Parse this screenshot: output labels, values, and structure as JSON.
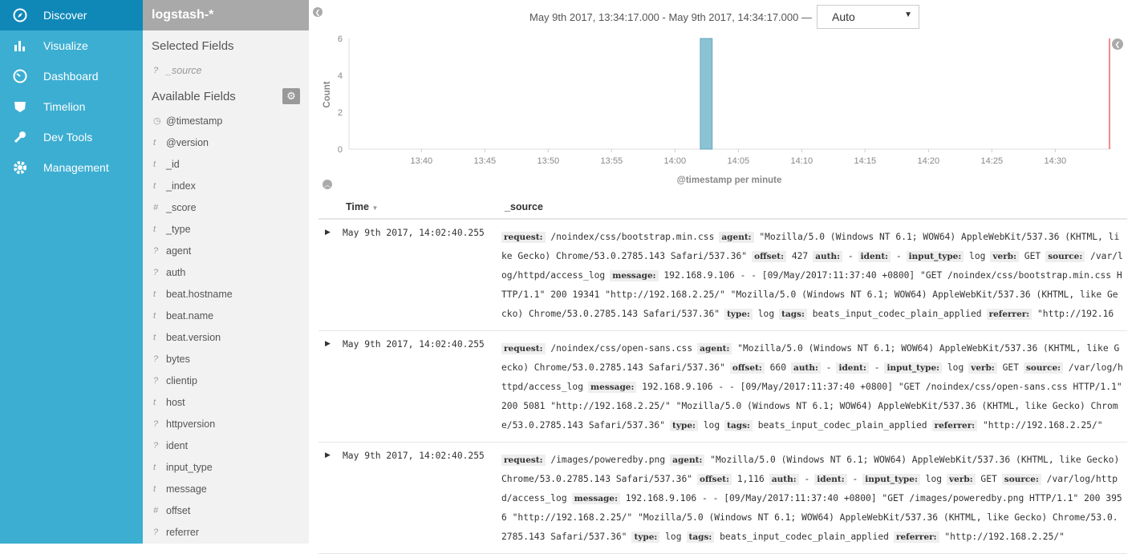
{
  "nav": [
    {
      "label": "Discover",
      "icon": "compass-icon",
      "active": true
    },
    {
      "label": "Visualize",
      "icon": "bar-chart-icon"
    },
    {
      "label": "Dashboard",
      "icon": "dashboard-icon"
    },
    {
      "label": "Timelion",
      "icon": "timelion-icon"
    },
    {
      "label": "Dev Tools",
      "icon": "wrench-icon"
    },
    {
      "label": "Management",
      "icon": "gear-icon"
    }
  ],
  "index_pattern": "logstash-*",
  "selected_fields_title": "Selected Fields",
  "selected_fields": [
    {
      "type": "?",
      "name": "_source"
    }
  ],
  "available_fields_title": "Available Fields",
  "available_fields": [
    {
      "type": "clock",
      "name": "@timestamp"
    },
    {
      "type": "t",
      "name": "@version"
    },
    {
      "type": "t",
      "name": "_id"
    },
    {
      "type": "t",
      "name": "_index"
    },
    {
      "type": "#",
      "name": "_score"
    },
    {
      "type": "t",
      "name": "_type"
    },
    {
      "type": "?",
      "name": "agent"
    },
    {
      "type": "?",
      "name": "auth"
    },
    {
      "type": "t",
      "name": "beat.hostname"
    },
    {
      "type": "t",
      "name": "beat.name"
    },
    {
      "type": "t",
      "name": "beat.version"
    },
    {
      "type": "?",
      "name": "bytes"
    },
    {
      "type": "?",
      "name": "clientip"
    },
    {
      "type": "t",
      "name": "host"
    },
    {
      "type": "?",
      "name": "httpversion"
    },
    {
      "type": "?",
      "name": "ident"
    },
    {
      "type": "t",
      "name": "input_type"
    },
    {
      "type": "t",
      "name": "message"
    },
    {
      "type": "#",
      "name": "offset"
    },
    {
      "type": "?",
      "name": "referrer"
    }
  ],
  "time_range": "May 9th 2017, 13:34:17.000 - May 9th 2017, 14:34:17.000 —",
  "interval": "Auto",
  "chart_data": {
    "type": "bar",
    "xlabel": "@timestamp per minute",
    "ylabel": "Count",
    "x_range": [
      "13:34:17",
      "14:34:17"
    ],
    "ylim": [
      0,
      6
    ],
    "yticks": [
      0,
      2,
      4,
      6
    ],
    "xticks": [
      "13:40",
      "13:45",
      "13:50",
      "13:55",
      "14:00",
      "14:05",
      "14:10",
      "14:15",
      "14:20",
      "14:25",
      "14:30"
    ],
    "bars": [
      {
        "x": "14:02",
        "value": 6
      }
    ],
    "bar_color": "#8bc3d4",
    "now_marker_color": "#e66"
  },
  "table": {
    "headers": {
      "time": "Time",
      "source": "_source"
    },
    "rows": [
      {
        "time": "May 9th 2017, 14:02:40.255",
        "fields": [
          [
            "request:",
            "/noindex/css/bootstrap.min.css"
          ],
          [
            "agent:",
            "\"Mozilla/5.0 (Windows NT 6.1; WOW64) AppleWebKit/537.36 (KHTML, like Gecko) Chrome/53.0.2785.143 Safari/537.36\""
          ],
          [
            "offset:",
            "427"
          ],
          [
            "auth:",
            "-"
          ],
          [
            "ident:",
            "-"
          ],
          [
            "input_type:",
            "log"
          ],
          [
            "verb:",
            "GET"
          ],
          [
            "source:",
            "/var/log/httpd/access_log"
          ],
          [
            "message:",
            "192.168.9.106 - - [09/May/2017:11:37:40 +0800] \"GET /noindex/css/bootstrap.min.css HTTP/1.1\" 200 19341 \"http://192.168.2.25/\" \"Mozilla/5.0 (Windows NT 6.1; WOW64) AppleWebKit/537.36 (KHTML, like Gecko) Chrome/53.0.2785.143 Safari/537.36\""
          ],
          [
            "type:",
            "log"
          ],
          [
            "tags:",
            "beats_input_codec_plain_applied"
          ],
          [
            "referrer:",
            "\"http://192.168.2.25/\""
          ]
        ]
      },
      {
        "time": "May 9th 2017, 14:02:40.255",
        "fields": [
          [
            "request:",
            "/noindex/css/open-sans.css"
          ],
          [
            "agent:",
            "\"Mozilla/5.0 (Windows NT 6.1; WOW64) AppleWebKit/537.36 (KHTML, like Gecko) Chrome/53.0.2785.143 Safari/537.36\""
          ],
          [
            "offset:",
            "660"
          ],
          [
            "auth:",
            "-"
          ],
          [
            "ident:",
            "-"
          ],
          [
            "input_type:",
            "log"
          ],
          [
            "verb:",
            "GET"
          ],
          [
            "source:",
            "/var/log/httpd/access_log"
          ],
          [
            "message:",
            "192.168.9.106 - - [09/May/2017:11:37:40 +0800] \"GET /noindex/css/open-sans.css HTTP/1.1\" 200 5081 \"http://192.168.2.25/\" \"Mozilla/5.0 (Windows NT 6.1; WOW64) AppleWebKit/537.36 (KHTML, like Gecko) Chrome/53.0.2785.143 Safari/537.36\""
          ],
          [
            "type:",
            "log"
          ],
          [
            "tags:",
            "beats_input_codec_plain_applied"
          ],
          [
            "referrer:",
            "\"http://192.168.2.25/\""
          ]
        ]
      },
      {
        "time": "May 9th 2017, 14:02:40.255",
        "fields": [
          [
            "request:",
            "/images/poweredby.png"
          ],
          [
            "agent:",
            "\"Mozilla/5.0 (Windows NT 6.1; WOW64) AppleWebKit/537.36 (KHTML, like Gecko) Chrome/53.0.2785.143 Safari/537.36\""
          ],
          [
            "offset:",
            "1,116"
          ],
          [
            "auth:",
            "-"
          ],
          [
            "ident:",
            "-"
          ],
          [
            "input_type:",
            "log"
          ],
          [
            "verb:",
            "GET"
          ],
          [
            "source:",
            "/var/log/httpd/access_log"
          ],
          [
            "message:",
            "192.168.9.106 - - [09/May/2017:11:37:40 +0800] \"GET /images/poweredby.png HTTP/1.1\" 200 3956 \"http://192.168.2.25/\" \"Mozilla/5.0 (Windows NT 6.1; WOW64) AppleWebKit/537.36 (KHTML, like Gecko) Chrome/53.0.2785.143 Safari/537.36\""
          ],
          [
            "type:",
            "log"
          ],
          [
            "tags:",
            "beats_input_codec_plain_applied"
          ],
          [
            "referrer:",
            "\"http://192.168.2.25/\""
          ]
        ]
      }
    ]
  }
}
